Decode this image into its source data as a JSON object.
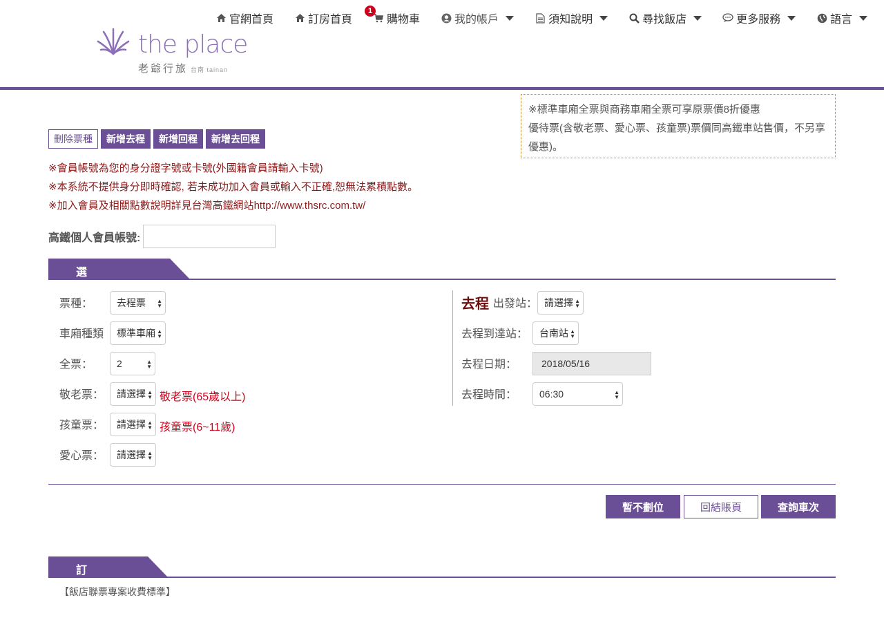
{
  "nav": {
    "items": [
      {
        "label": "官網首頁",
        "icon": "home-icon"
      },
      {
        "label": "訂房首頁",
        "icon": "home-icon"
      },
      {
        "label": "購物車",
        "icon": "cart-icon",
        "badge": "1"
      },
      {
        "label": "我的帳戶",
        "icon": "user-circle-icon"
      },
      {
        "label": "須知說明",
        "icon": "document-icon"
      },
      {
        "label": "尋找飯店",
        "icon": "search-icon"
      },
      {
        "label": "更多服務",
        "icon": "chat-icon"
      },
      {
        "label": "語言",
        "icon": "globe-icon"
      }
    ]
  },
  "logo": {
    "name": "the place",
    "sub": "老爺行旅",
    "sub_small": "台南 tainan"
  },
  "notice": {
    "line1": "※標準車廂全票與商務車廂全票可享原票價8折優惠",
    "line2": "優待票(含敬老票、愛心票、孩童票)票價同高鐵車站售價，不另享優惠)。"
  },
  "buttons": {
    "delete_ticket": "刪除票種",
    "add_outbound": "新增去程",
    "add_return": "新增回程",
    "add_roundtrip": "新增去回程",
    "hold": "暫不劃位",
    "back_checkout": "回結賬頁",
    "search_trains": "查詢車次"
  },
  "notes": [
    "※會員帳號為您的身分證字號或卡號(外國籍會員請輸入卡號)",
    "※本系統不提供身分即時確認, 若未成功加入會員或輸入不正確,恕無法累積點數。",
    "※加入會員及相關點數說明詳見台灣高鐵網站http://www.thsrc.com.tw/"
  ],
  "member": {
    "label": "高鐵個人會員帳號:",
    "value": ""
  },
  "section1": {
    "title": "選擇查詢條件"
  },
  "section2": {
    "title": "訂票方式"
  },
  "form": {
    "ticket_type": {
      "label": "票種：",
      "value": "去程票"
    },
    "car_type": {
      "label": "車廂種類",
      "value": "標準車廂"
    },
    "adult": {
      "label": "全票：",
      "value": "2"
    },
    "senior": {
      "label": "敬老票：",
      "value": "請選擇",
      "hint": "敬老票(65歲以上)"
    },
    "child": {
      "label": "孩童票：",
      "value": "請選擇",
      "hint": "孩童票(6~11歲)"
    },
    "disabled": {
      "label": "愛心票：",
      "value": "請選擇"
    },
    "go_title": "去程",
    "depart": {
      "label": "出發站：",
      "value": "請選擇"
    },
    "arrive": {
      "label": "去程到達站：",
      "value": "台南站"
    },
    "date": {
      "label": "去程日期：",
      "value": "2018/05/16"
    },
    "time": {
      "label": "去程時間：",
      "value": "06:30"
    }
  },
  "cut_text": "【飯店聯票專案收費標準】",
  "colors": {
    "accent": "#6b4f96",
    "alert": "#d0021b",
    "note": "#8b1a1a"
  }
}
